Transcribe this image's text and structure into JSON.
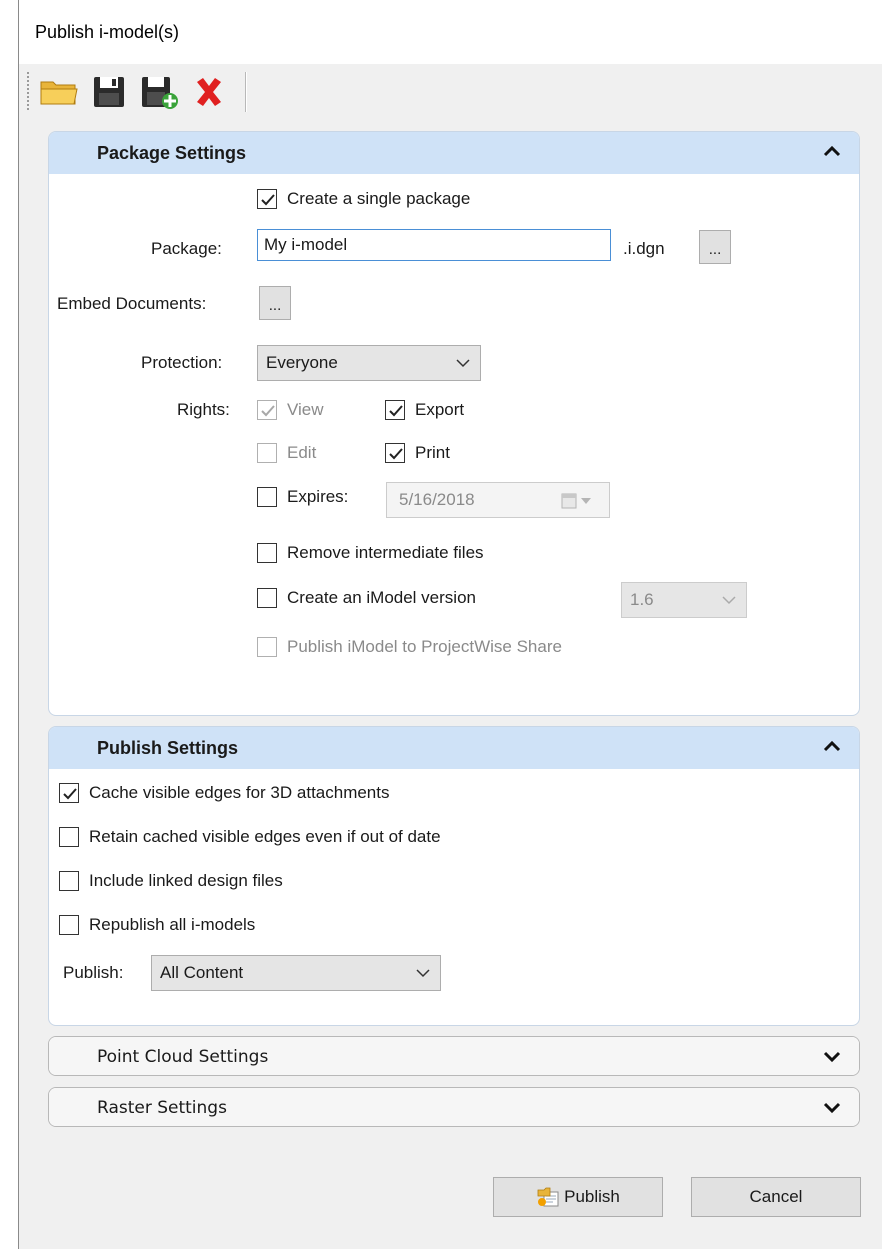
{
  "window": {
    "title": "Publish i-model(s)"
  },
  "toolbar": {
    "open_icon": "folder-open-icon",
    "save_icon": "save-icon",
    "save_as_icon": "save-as-icon",
    "delete_icon": "delete-icon"
  },
  "package_settings": {
    "title": "Package Settings",
    "create_single_package": {
      "label": "Create a single package",
      "checked": true
    },
    "package_label": "Package:",
    "package_value": "My i-model",
    "package_suffix": ".i.dgn",
    "browse_label": "...",
    "embed_documents_label": "Embed Documents:",
    "embed_browse_label": "...",
    "protection_label": "Protection:",
    "protection_value": "Everyone",
    "rights_label": "Rights:",
    "rights": {
      "view": {
        "label": "View",
        "checked": true,
        "enabled": false
      },
      "export": {
        "label": "Export",
        "checked": true,
        "enabled": true
      },
      "edit": {
        "label": "Edit",
        "checked": false,
        "enabled": false
      },
      "print": {
        "label": "Print",
        "checked": true,
        "enabled": true
      }
    },
    "expires": {
      "label": "Expires:",
      "checked": false,
      "date": "5/16/2018"
    },
    "remove_intermediate": {
      "label": "Remove intermediate files",
      "checked": false
    },
    "create_imodel_version": {
      "label": "Create an iModel version",
      "checked": false,
      "version": "1.6"
    },
    "publish_projectwise": {
      "label": "Publish iModel to ProjectWise Share",
      "checked": false,
      "enabled": false
    }
  },
  "publish_settings": {
    "title": "Publish Settings",
    "cache_visible_edges": {
      "label": "Cache visible edges for 3D attachments",
      "checked": true
    },
    "retain_cached_edges": {
      "label": "Retain cached visible edges even if out of date",
      "checked": false
    },
    "include_linked": {
      "label": "Include linked design files",
      "checked": false
    },
    "republish_all": {
      "label": "Republish all i-models",
      "checked": false
    },
    "publish_label": "Publish:",
    "publish_value": "All Content"
  },
  "point_cloud_settings": {
    "title": "Point Cloud Settings"
  },
  "raster_settings": {
    "title": "Raster Settings"
  },
  "buttons": {
    "publish": "Publish",
    "cancel": "Cancel"
  }
}
